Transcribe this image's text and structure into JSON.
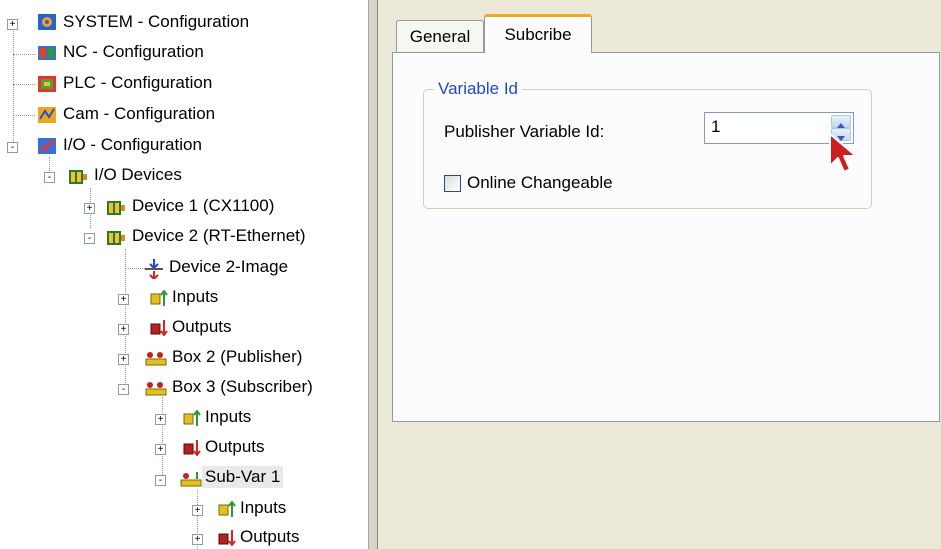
{
  "tree": {
    "items": [
      {
        "label": "SYSTEM - Configuration",
        "icon": "system-config-icon",
        "expander": "+"
      },
      {
        "label": "NC - Configuration",
        "icon": "nc-config-icon"
      },
      {
        "label": "PLC - Configuration",
        "icon": "plc-config-icon"
      },
      {
        "label": "Cam - Configuration",
        "icon": "cam-config-icon"
      },
      {
        "label": "I/O - Configuration",
        "icon": "io-config-icon",
        "expander": "-"
      },
      {
        "label": "I/O Devices",
        "icon": "io-devices-icon",
        "expander": "-"
      },
      {
        "label": "Device 1 (CX1100)",
        "icon": "device-icon",
        "expander": "+"
      },
      {
        "label": "Device 2 (RT-Ethernet)",
        "icon": "device-icon",
        "expander": "-"
      },
      {
        "label": "Device 2-Image",
        "icon": "process-image-icon"
      },
      {
        "label": "Inputs",
        "icon": "inputs-icon",
        "expander": "+"
      },
      {
        "label": "Outputs",
        "icon": "outputs-icon",
        "expander": "+"
      },
      {
        "label": "Box 2 (Publisher)",
        "icon": "box-icon",
        "expander": "+"
      },
      {
        "label": "Box 3 (Subscriber)",
        "icon": "box-icon",
        "expander": "-"
      },
      {
        "label": "Inputs",
        "icon": "inputs-icon",
        "expander": "+"
      },
      {
        "label": "Outputs",
        "icon": "outputs-icon",
        "expander": "+"
      },
      {
        "label": "Sub-Var 1",
        "icon": "sub-var-icon",
        "expander": "-",
        "selected": true
      },
      {
        "label": "Inputs",
        "icon": "inputs-icon",
        "expander": "+"
      },
      {
        "label": "Outputs",
        "icon": "outputs-icon",
        "expander": "+"
      }
    ]
  },
  "tabs": [
    {
      "label": "General",
      "active": false
    },
    {
      "label": "Subcribe",
      "active": true
    }
  ],
  "group": {
    "title": "Variable Id",
    "publisher_label": "Publisher Variable Id:",
    "publisher_value": "1",
    "online_changeable_label": "Online Changeable",
    "online_changeable_checked": false
  },
  "colors": {
    "panel_bg": "#ece9d8",
    "group_title": "#1f49c4",
    "active_tab_accent": "#f5a623",
    "cursor": "#cc1f1f"
  }
}
